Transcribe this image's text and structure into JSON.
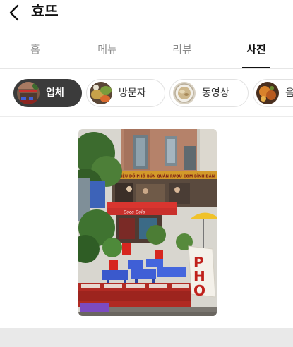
{
  "header": {
    "title": "효뜨",
    "back_icon": "chevron-left-icon"
  },
  "tabs": [
    {
      "label": "홈",
      "active": false
    },
    {
      "label": "메뉴",
      "active": false
    },
    {
      "label": "리뷰",
      "active": false
    },
    {
      "label": "사진",
      "active": true
    }
  ],
  "filters": [
    {
      "label": "업체",
      "active": true,
      "thumb": "storefront-thumbnail"
    },
    {
      "label": "방문자",
      "active": false,
      "thumb": "visitor-food-thumbnail"
    },
    {
      "label": "동영상",
      "active": false,
      "thumb": "video-dish-thumbnail"
    },
    {
      "label": "음",
      "active": false,
      "thumb": "food-thumbnail"
    }
  ],
  "photo": {
    "awning_text": "Coca-Cola",
    "banner_text": "HIỆU ĐỒ PHỞ BÚN QUÁN RƯỢU CƠM BÌNH DÂN",
    "sign_text": "PHO",
    "colors": {
      "brick": "#b5826a",
      "awning": "#c9302c",
      "stools": "#3f5fd6",
      "crates": "#b12a23",
      "foliage": "#3c6b2e"
    }
  },
  "colors": {
    "active_chip": "#3b3b3b",
    "inactive_tab": "#8c8c8c",
    "bottom_band": "#e9e9e9"
  }
}
